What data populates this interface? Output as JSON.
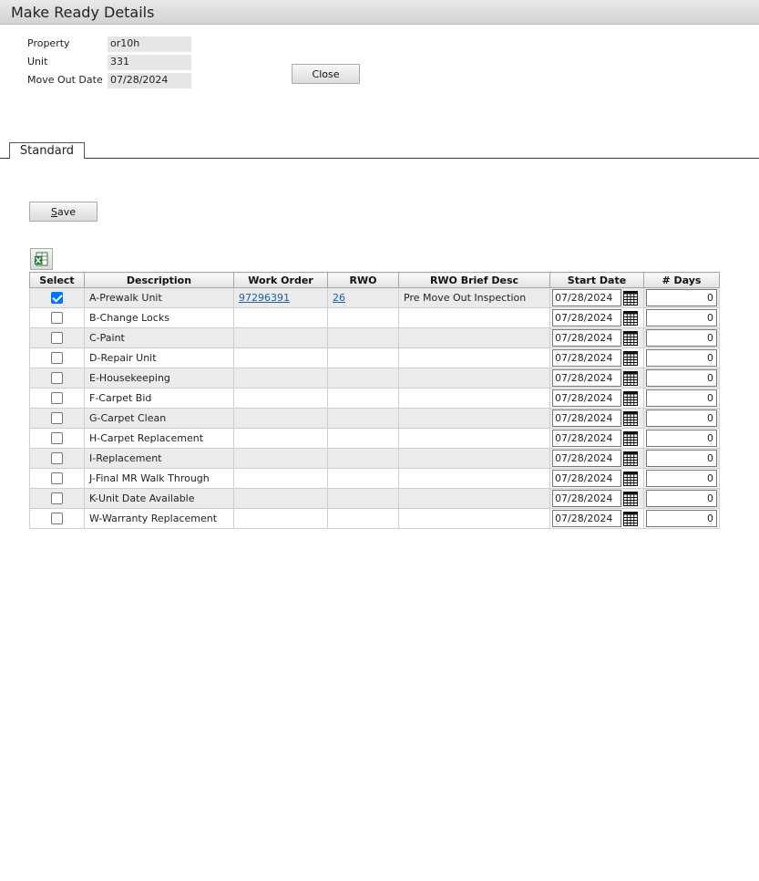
{
  "header": {
    "title": "Make Ready Details"
  },
  "info": {
    "property_label": "Property",
    "property_value": "or10h",
    "unit_label": "Unit",
    "unit_value": "331",
    "moveout_label": "Move Out Date",
    "moveout_value": "07/28/2024"
  },
  "buttons": {
    "close": "Close",
    "save_rest": "ave",
    "save_key": "S"
  },
  "tabs": [
    {
      "label": "Standard",
      "active": true
    }
  ],
  "toolbar": {
    "export_icon": "excel-export-icon"
  },
  "table": {
    "columns": [
      "Select",
      "Description",
      "Work Order",
      "RWO",
      "RWO Brief Desc",
      "Start Date",
      "# Days"
    ],
    "rows": [
      {
        "checked": true,
        "description": "A-Prewalk Unit",
        "work_order": "97296391",
        "rwo": "26",
        "rwo_desc": "Pre Move Out Inspection",
        "start_date": "07/28/2024",
        "days": "0"
      },
      {
        "checked": false,
        "description": "B-Change Locks",
        "work_order": "",
        "rwo": "",
        "rwo_desc": "",
        "start_date": "07/28/2024",
        "days": "0"
      },
      {
        "checked": false,
        "description": "C-Paint",
        "work_order": "",
        "rwo": "",
        "rwo_desc": "",
        "start_date": "07/28/2024",
        "days": "0"
      },
      {
        "checked": false,
        "description": "D-Repair Unit",
        "work_order": "",
        "rwo": "",
        "rwo_desc": "",
        "start_date": "07/28/2024",
        "days": "0"
      },
      {
        "checked": false,
        "description": "E-Housekeeping",
        "work_order": "",
        "rwo": "",
        "rwo_desc": "",
        "start_date": "07/28/2024",
        "days": "0"
      },
      {
        "checked": false,
        "description": "F-Carpet Bid",
        "work_order": "",
        "rwo": "",
        "rwo_desc": "",
        "start_date": "07/28/2024",
        "days": "0"
      },
      {
        "checked": false,
        "description": "G-Carpet Clean",
        "work_order": "",
        "rwo": "",
        "rwo_desc": "",
        "start_date": "07/28/2024",
        "days": "0"
      },
      {
        "checked": false,
        "description": "H-Carpet Replacement",
        "work_order": "",
        "rwo": "",
        "rwo_desc": "",
        "start_date": "07/28/2024",
        "days": "0"
      },
      {
        "checked": false,
        "description": "I-Replacement",
        "work_order": "",
        "rwo": "",
        "rwo_desc": "",
        "start_date": "07/28/2024",
        "days": "0"
      },
      {
        "checked": false,
        "description": "J-Final MR Walk Through",
        "work_order": "",
        "rwo": "",
        "rwo_desc": "",
        "start_date": "07/28/2024",
        "days": "0"
      },
      {
        "checked": false,
        "description": "K-Unit Date Available",
        "work_order": "",
        "rwo": "",
        "rwo_desc": "",
        "start_date": "07/28/2024",
        "days": "0"
      },
      {
        "checked": false,
        "description": "W-Warranty Replacement",
        "work_order": "",
        "rwo": "",
        "rwo_desc": "",
        "start_date": "07/28/2024",
        "days": "0"
      }
    ]
  }
}
